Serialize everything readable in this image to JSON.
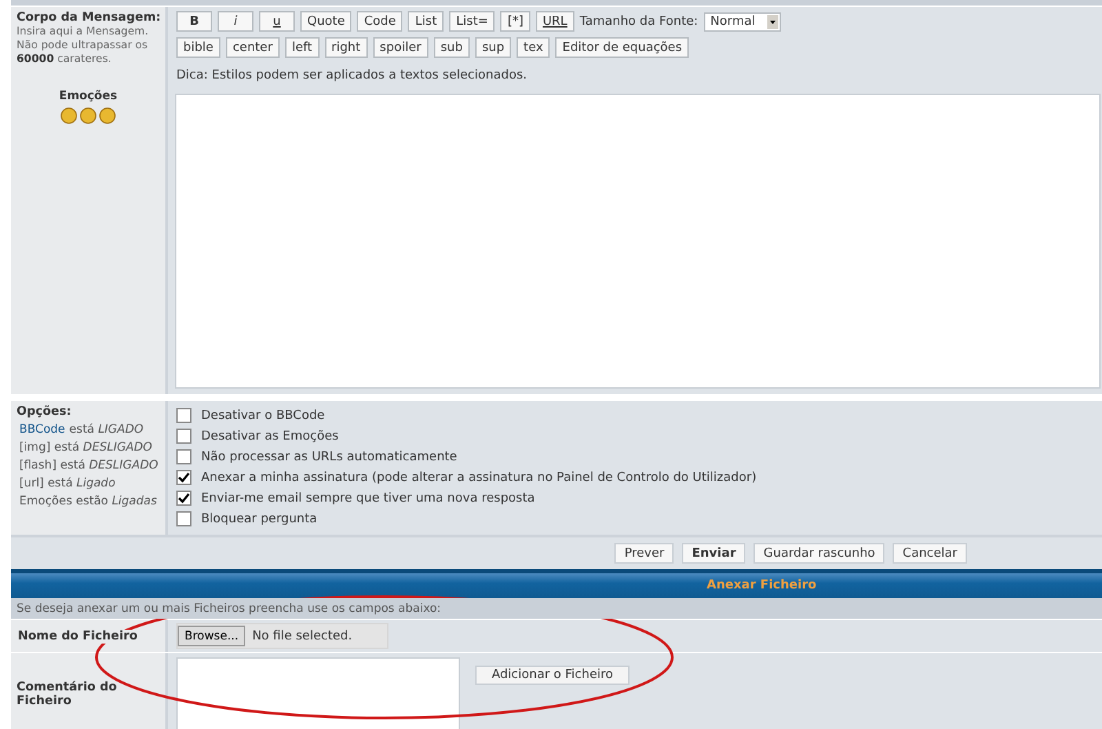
{
  "message": {
    "label": "Corpo da Mensagem:",
    "hint": "Insira aqui a Mensagem. Não pode ultrapassar os **60000** carateres.",
    "emotions_label": "Emoções",
    "toolbar_row_1": [
      {
        "label": "B",
        "kind": "bold"
      },
      {
        "label": "i",
        "kind": "italic"
      },
      {
        "label": "u",
        "kind": "underline"
      },
      {
        "label": "Quote",
        "kind": "plain"
      },
      {
        "label": "Code",
        "kind": "plain"
      },
      {
        "label": "List",
        "kind": "plain"
      },
      {
        "label": "List=",
        "kind": "plain"
      },
      {
        "label": "[*]",
        "kind": "plain"
      },
      {
        "label": "URL",
        "kind": "underline"
      }
    ],
    "font_size_label": "Tamanho da Fonte:",
    "font_size_value": "Normal",
    "toolbar_row_2": [
      "bible",
      "center",
      "left",
      "right",
      "spoiler",
      "sub",
      "sup",
      "tex",
      "Editor de equações"
    ],
    "tip": "Dica: Estilos podem ser aplicados a textos selecionados."
  },
  "options": {
    "label": "Opções:",
    "status": [
      {
        "link": "BBCode",
        "text": "está *LIGADO*"
      },
      {
        "text": "[img] está *DESLIGADO*"
      },
      {
        "text": "[flash] está *DESLIGADO*"
      },
      {
        "text": "[url] está *Ligado*"
      },
      {
        "text": "Emoções estão *Ligadas*"
      }
    ],
    "checkboxes": [
      {
        "label": "Desativar o BBCode",
        "checked": false
      },
      {
        "label": "Desativar as Emoções",
        "checked": false
      },
      {
        "label": "Não processar as URLs automaticamente",
        "checked": false
      },
      {
        "label": "Anexar a minha assinatura (pode alterar a assinatura no Painel de Controlo do Utilizador)",
        "checked": true
      },
      {
        "label": "Enviar-me email sempre que tiver uma nova resposta",
        "checked": true
      },
      {
        "label": "Bloquear pergunta",
        "checked": false
      }
    ]
  },
  "actions": [
    {
      "label": "Prever",
      "kind": "normal"
    },
    {
      "label": "Enviar",
      "kind": "primary"
    },
    {
      "label": "Guardar rascunho",
      "kind": "normal"
    },
    {
      "label": "Cancelar",
      "kind": "normal"
    }
  ],
  "attach": {
    "title": "Anexar Ficheiro",
    "hint": "Se deseja anexar um ou mais Ficheiros preencha use os campos abaixo:",
    "file_label": "Nome do Ficheiro",
    "browse": "Browse...",
    "no_file": "No file selected.",
    "comment_label": "Comentário do Ficheiro",
    "add_button": "Adicionar o Ficheiro"
  }
}
